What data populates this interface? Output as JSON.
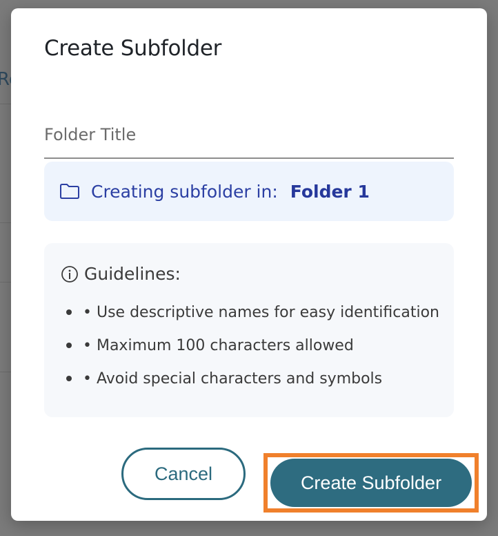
{
  "background": {
    "partial_text": "Re"
  },
  "dialog": {
    "title": "Create Subfolder",
    "field": {
      "placeholder": "Folder Title",
      "value": ""
    },
    "location": {
      "icon": "folder-icon",
      "prefix": "Creating subfolder in:",
      "folder_name": "Folder 1"
    },
    "guidelines": {
      "icon": "info-icon",
      "title": "Guidelines:",
      "items": [
        "• Use descriptive names for easy identification",
        "• Maximum 100 characters allowed",
        "• Avoid special characters and symbols"
      ]
    },
    "buttons": {
      "cancel": "Cancel",
      "create": "Create Subfolder"
    }
  },
  "colors": {
    "accent": "#2e6c80",
    "highlight": "#f0802c",
    "info_bg": "#eef4fd",
    "info_text": "#2b3fa3"
  }
}
